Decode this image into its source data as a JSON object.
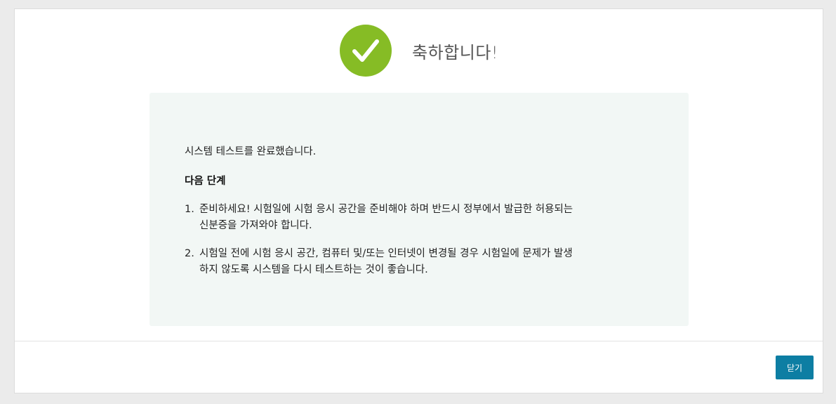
{
  "dialog": {
    "title": "축하합니다!",
    "success_icon": "check-mark-icon",
    "success_color": "#86bc25",
    "message": "시스템 테스트를 완료했습니다.",
    "next_steps_heading": "다음 단계",
    "steps": [
      {
        "number": "1.",
        "line1": "준비하세요! 시험일에 시험 응시 공간을 준비해야 하며 반드시 정부에서 발급한 허용되는",
        "line2": "신분증을 가져와야 합니다."
      },
      {
        "number": "2.",
        "line1": "시험일 전에 시험 응시 공간, 컴퓨터 및/또는 인터넷이 변경될 경우 시험일에 문제가 발생",
        "line2": "하지 않도록 시스템을 다시 테스트하는 것이 좋습니다."
      }
    ],
    "close_label": "닫기",
    "button_color": "#0d7ea3"
  }
}
